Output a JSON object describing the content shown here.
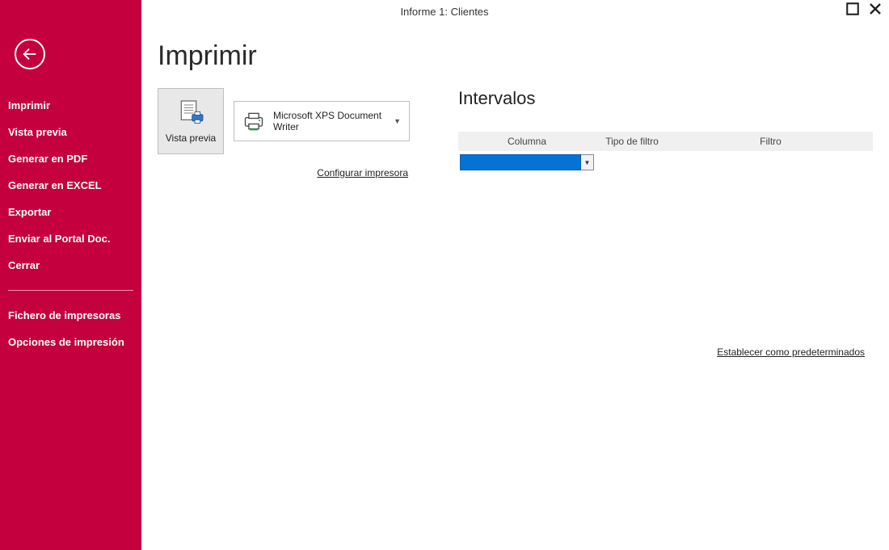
{
  "window": {
    "title": "Informe 1: Clientes"
  },
  "sidebar": {
    "items_top": [
      "Imprimir",
      "Vista previa",
      "Generar en PDF",
      "Generar en EXCEL",
      "Exportar",
      "Enviar al Portal Doc.",
      "Cerrar"
    ],
    "items_bottom": [
      "Fichero de impresoras",
      "Opciones de impresión"
    ]
  },
  "main": {
    "page_title": "Imprimir",
    "preview_label": "Vista previa",
    "printer_name": "Microsoft XPS Document Writer",
    "configure_printer": "Configurar impresora",
    "intervals": {
      "heading": "Intervalos",
      "columns": {
        "columna": "Columna",
        "tipo": "Tipo de filtro",
        "filtro": "Filtro"
      },
      "row0": {
        "columna": "",
        "tipo": "",
        "filtro": ""
      }
    },
    "set_default": "Establecer como predeterminados"
  }
}
